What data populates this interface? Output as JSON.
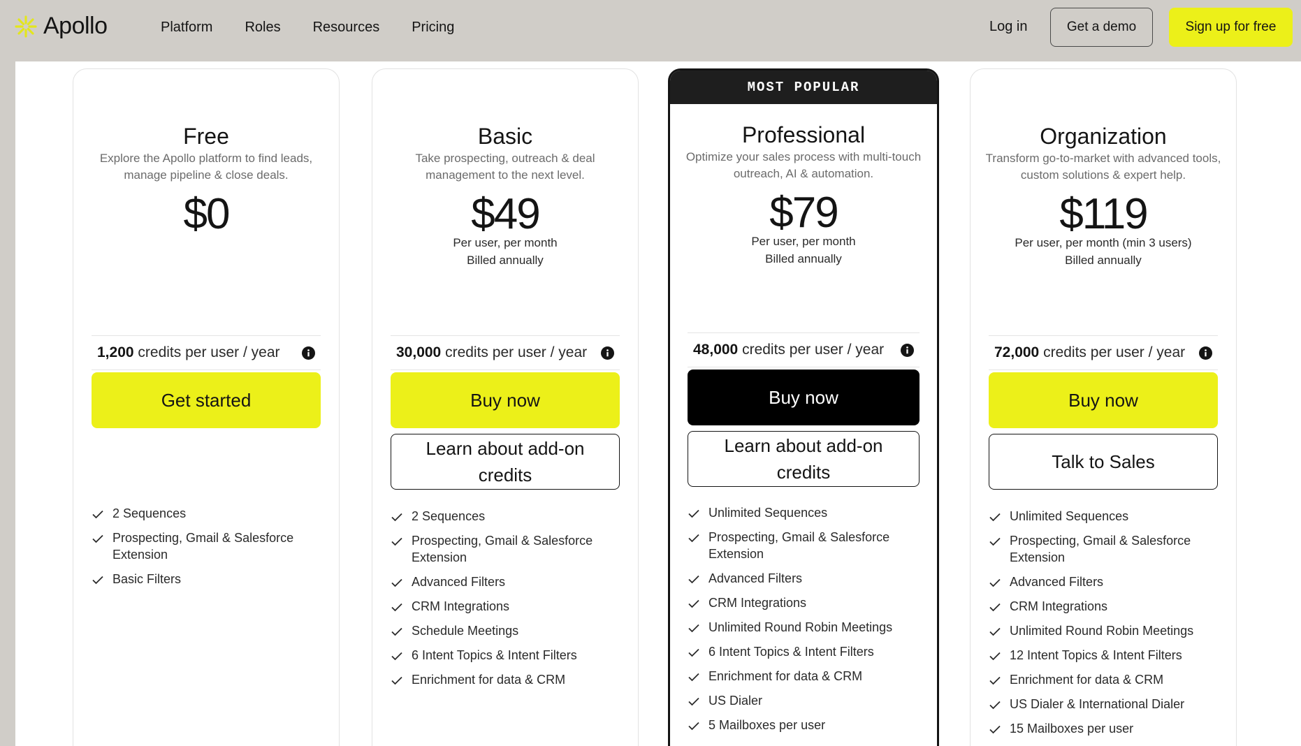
{
  "brand": {
    "name": "Apollo",
    "accent": "#ecf019"
  },
  "nav": {
    "links": [
      "Platform",
      "Roles",
      "Resources",
      "Pricing"
    ],
    "login": "Log in",
    "demo": "Get a demo",
    "signup": "Sign up for free"
  },
  "plans": [
    {
      "name": "Free",
      "description": "Explore the Apollo platform to find leads, manage pipeline & close deals.",
      "price": "$0",
      "billing_1": "",
      "billing_2": "",
      "credits_amount": "1,200",
      "credits_text": "credits per user / year",
      "primary_cta": "Get started",
      "secondary_cta": "",
      "features": [
        "2 Sequences",
        "Prospecting, Gmail & Salesforce Extension",
        "Basic Filters"
      ]
    },
    {
      "name": "Basic",
      "description": "Take prospecting, outreach & deal management to the next level.",
      "price": "$49",
      "billing_1": "Per user, per month",
      "billing_2": "Billed annually",
      "credits_amount": "30,000",
      "credits_text": "credits per user / year",
      "primary_cta": "Buy now",
      "secondary_cta": "Learn about add-on credits",
      "features": [
        "2 Sequences",
        "Prospecting, Gmail & Salesforce Extension",
        "Advanced Filters",
        "CRM Integrations",
        "Schedule Meetings",
        "6 Intent Topics & Intent Filters",
        "Enrichment for data & CRM"
      ]
    },
    {
      "badge": "MOST POPULAR",
      "name": "Professional",
      "description": "Optimize your sales process with multi-touch outreach, AI & automation.",
      "price": "$79",
      "billing_1": "Per user, per month",
      "billing_2": "Billed annually",
      "credits_amount": "48,000",
      "credits_text": "credits per user / year",
      "primary_cta": "Buy now",
      "secondary_cta": "Learn about add-on credits",
      "features": [
        "Unlimited Sequences",
        "Prospecting, Gmail & Salesforce Extension",
        "Advanced Filters",
        "CRM Integrations",
        "Unlimited Round Robin Meetings",
        "6 Intent Topics & Intent Filters",
        "Enrichment for data & CRM",
        "US Dialer",
        "5 Mailboxes per user"
      ]
    },
    {
      "name": "Organization",
      "description": "Transform go-to-market with advanced tools, custom solutions & expert help.",
      "price": "$119",
      "billing_1": "Per user, per month (min 3 users)",
      "billing_2": "Billed annually",
      "credits_amount": "72,000",
      "credits_text": "credits per user / year",
      "primary_cta": "Buy now",
      "secondary_cta": "Talk to Sales",
      "features": [
        "Unlimited Sequences",
        "Prospecting, Gmail & Salesforce Extension",
        "Advanced Filters",
        "CRM Integrations",
        "Unlimited Round Robin Meetings",
        "12 Intent Topics & Intent Filters",
        "Enrichment for data & CRM",
        "US Dialer & International Dialer",
        "15 Mailboxes per user"
      ]
    }
  ]
}
